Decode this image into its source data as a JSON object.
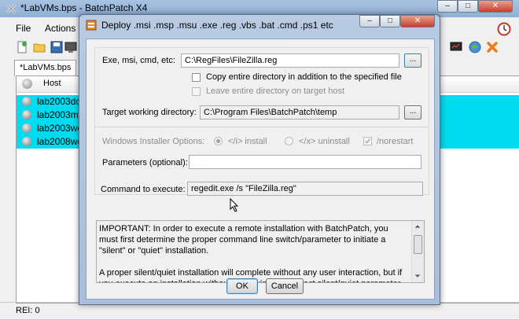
{
  "main_window": {
    "title": "*LabVMs.bps - BatchPatch X4",
    "menu": [
      "File",
      "Actions"
    ],
    "tab_label": "*LabVMs.bps",
    "column_header": "Host",
    "rows": [
      "lab2003dc",
      "lab2003me",
      "lab2003wo",
      "lab2008wo"
    ],
    "row_color": "#00dcef",
    "status": "REI: 0"
  },
  "dialog": {
    "title": "Deploy .msi .msp .msu .exe .reg .vbs .bat .cmd .ps1 etc",
    "exe_label": "Exe, msi, cmd, etc:",
    "exe_value": "C:\\RegFiles\\FileZilla.reg",
    "browse_label": "...",
    "copy_dir_label": "Copy entire directory in addition to the specified file",
    "leave_dir_label": "Leave entire directory on target host",
    "target_dir_label": "Target working directory:",
    "target_dir_value": "C:\\Program Files\\BatchPatch\\temp",
    "installer_options_label": "Windows Installer Options:",
    "install_option": "</i> install",
    "uninstall_option": "</x> uninstall",
    "norestart_option": "/norestart",
    "parameters_label": "Parameters (optional):",
    "parameters_value": "",
    "command_label": "Command to execute:",
    "command_value": "regedit.exe /s \"FileZilla.reg\"",
    "info_paragraph_1": "IMPORTANT: In order to execute a remote installation with BatchPatch, you must first determine the proper command line switch/parameter to initiate a \"silent\" or \"quiet\" installation.",
    "info_paragraph_2": "A proper silent/quiet installation will complete without any user interaction, but if you execute an installation without specifying the correct silent/quiet parameter, the",
    "ok_label": "OK",
    "cancel_label": "Cancel"
  },
  "icons": [
    "app-icon",
    "new-file-icon",
    "open-folder-icon",
    "save-icon",
    "computer-icon",
    "globe-icon",
    "close-x-icon",
    "clock-icon",
    "scroll-up-icon",
    "scroll-down-icon"
  ]
}
